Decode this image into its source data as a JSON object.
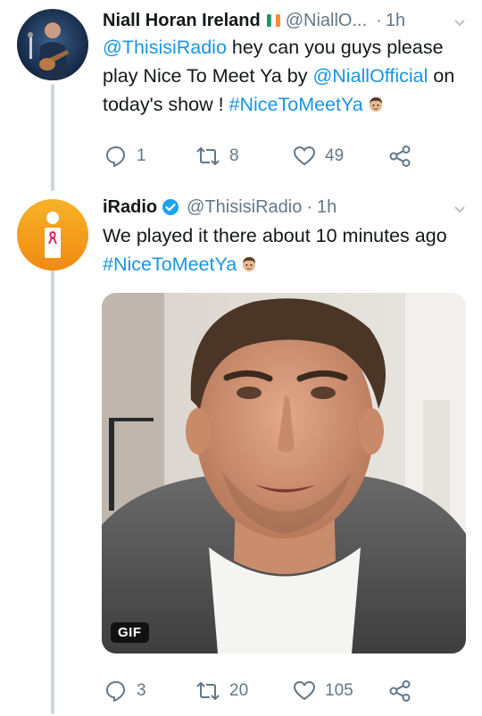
{
  "tweets": [
    {
      "name": "Niall Horan Ireland",
      "handle": "@NiallO...",
      "dot": "·",
      "time": "1h",
      "mention": "@ThisisiRadio",
      "text": " hey can you guys please play Nice To Meet Ya by ",
      "mention2": "@NiallOfficial",
      "text2": " on today's show ! ",
      "hashtag": "#NiceToMeetYa",
      "reply_count": "1",
      "retweet_count": "8",
      "like_count": "49"
    },
    {
      "name": "iRadio",
      "handle": "@ThisisiRadio",
      "dot": "·",
      "time": "1h",
      "text": "We played it there about 10 minutes ago",
      "hashtag": "#NiceToMeetYa",
      "media_badge": "GIF",
      "reply_count": "3",
      "retweet_count": "20",
      "like_count": "105"
    }
  ],
  "colors": {
    "link": "#1b95e0",
    "secondary": "#657786",
    "thread_line": "#ccd6dd",
    "verified": "#1da1f2",
    "iradio_orange": "#f5a11c"
  },
  "icons": {
    "reply": "reply-icon",
    "retweet": "retweet-icon",
    "like": "heart-icon",
    "share": "share-icon",
    "verified": "verified-badge-icon",
    "flag": "irish-flag-icon",
    "caret": "chevron-down-icon"
  }
}
